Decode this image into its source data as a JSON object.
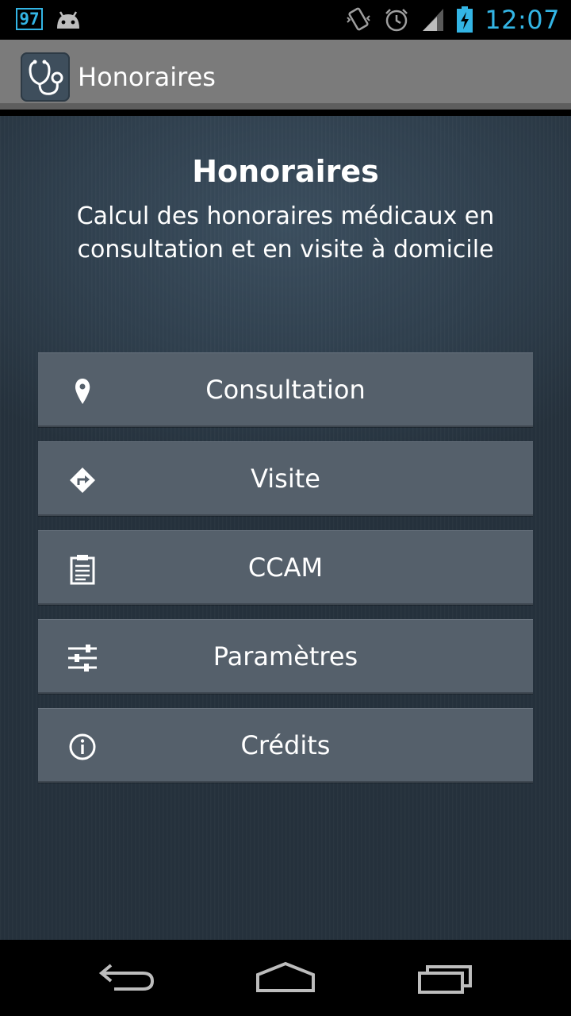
{
  "status_bar": {
    "notification_badge": "97",
    "time": "12:07",
    "icons": [
      "android-icon",
      "vibrate-icon",
      "alarm-icon",
      "signal-icon",
      "battery-charging-icon"
    ]
  },
  "action_bar": {
    "title": "Honoraires",
    "icon": "stethoscope-icon"
  },
  "main": {
    "heading": "Honoraires",
    "subheading": "Calcul des honoraires médicaux en consultation et en visite à domicile",
    "buttons": [
      {
        "label": "Consultation",
        "icon": "map-pin-icon"
      },
      {
        "label": "Visite",
        "icon": "directions-icon"
      },
      {
        "label": "CCAM",
        "icon": "clipboard-icon"
      },
      {
        "label": "Paramètres",
        "icon": "sliders-icon"
      },
      {
        "label": "Crédits",
        "icon": "info-icon"
      }
    ]
  },
  "nav_bar": {
    "icons": [
      "back-icon",
      "home-icon",
      "recent-apps-icon"
    ]
  },
  "colors": {
    "status_accent": "#33b5e5",
    "action_bar": "#7b7b7b",
    "button_bg": "#55606b",
    "content_bg": "#2f3f4d"
  }
}
